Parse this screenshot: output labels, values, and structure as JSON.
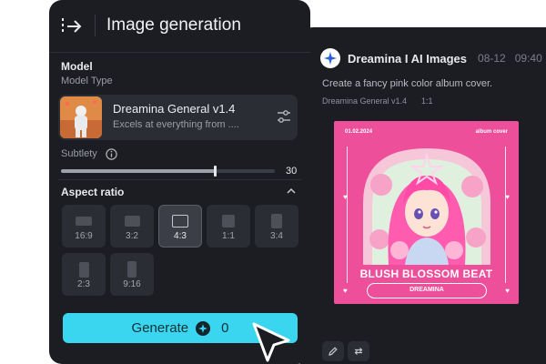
{
  "settings": {
    "title": "Image generation",
    "model_section": "Model",
    "model_type_label": "Model Type",
    "model_name": "Dreamina General v1.4",
    "model_desc": "Excels at everything from ....",
    "subtlety_label": "Subtlety",
    "subtlety_value": "30",
    "subtlety_fraction": 0.72,
    "aspect_ratio_label": "Aspect ratio",
    "ratios": [
      {
        "label": "16:9",
        "selected": false
      },
      {
        "label": "3:2",
        "selected": false
      },
      {
        "label": "4:3",
        "selected": true
      },
      {
        "label": "1:1",
        "selected": false
      },
      {
        "label": "3:4",
        "selected": false
      },
      {
        "label": "2:3",
        "selected": false
      },
      {
        "label": "9:16",
        "selected": false
      }
    ],
    "generate_label": "Generate",
    "generate_count": "0"
  },
  "chat": {
    "title": "Dreamina  I  AI Images",
    "date": "08-12",
    "time": "09:40",
    "prompt": "Create a fancy pink color album cover.",
    "model_tag": "Dreamina General v1.4",
    "ratio_tag": "1:1",
    "album": {
      "date": "01.02.2024",
      "label": "album cover",
      "name": "BLUSH BLOSSOM BEAT",
      "artist": "DREAMINA"
    }
  },
  "colors": {
    "panel_bg": "#1b1d23",
    "card_bg": "#2a2d34",
    "accent": "#3ad5ee",
    "album_pink": "#ee4f9b"
  },
  "icons": [
    "collapse-sidebar-icon",
    "settings-sliders-icon",
    "info-icon",
    "chevron-up-icon",
    "dreamina-star-icon",
    "edit-icon",
    "regenerate-icon",
    "pointer-cursor-icon"
  ]
}
